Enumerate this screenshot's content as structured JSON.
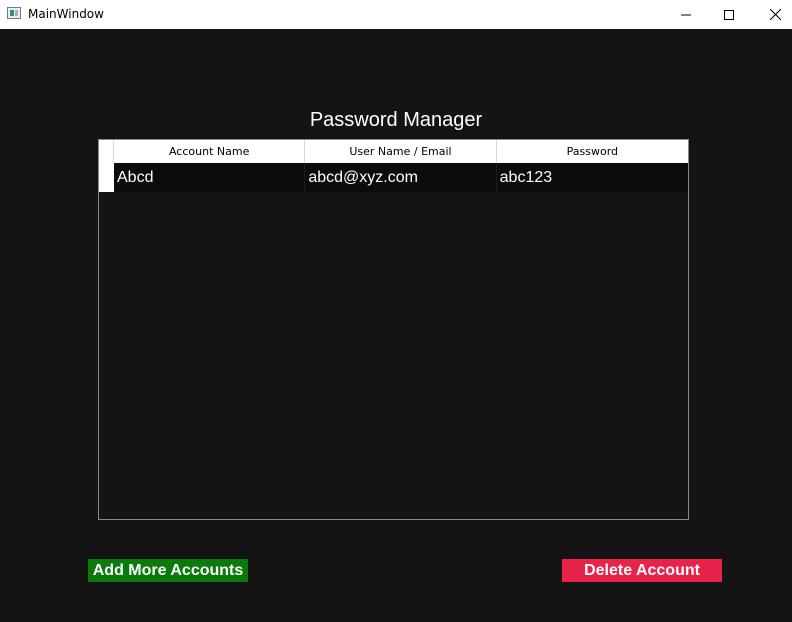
{
  "window": {
    "title": "MainWindow",
    "controls": [
      "minimize",
      "maximize",
      "close"
    ]
  },
  "main": {
    "heading": "Password Manager",
    "table": {
      "columns": [
        "Account Name",
        "User Name / Email",
        "Password"
      ],
      "rows": [
        [
          "Abcd",
          "abcd@xyz.com",
          "abc123"
        ]
      ]
    },
    "buttons": {
      "add_label": "Add More Accounts",
      "delete_label": "Delete Account"
    }
  },
  "colors": {
    "background": "#141414",
    "add_button": "#0a7a0a",
    "delete_button": "#e8234a",
    "text": "#ffffff"
  },
  "icons": [
    "app-icon",
    "minimize-icon",
    "maximize-icon",
    "close-icon"
  ]
}
